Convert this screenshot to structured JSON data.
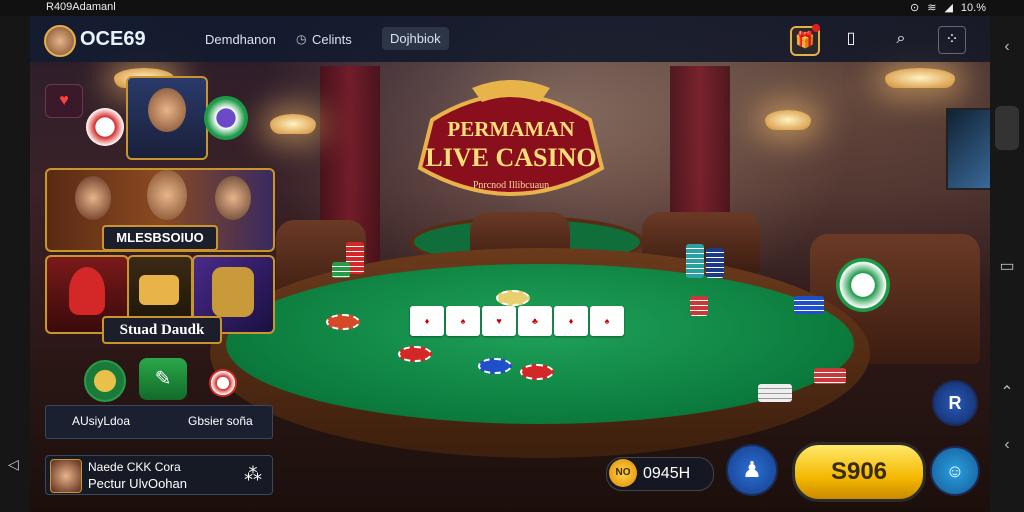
{
  "status_bar": {
    "left_text": "R409Adamanl",
    "battery": "10.%"
  },
  "header": {
    "brand": "OCE69",
    "nav": [
      "Demdhanon",
      "Celints",
      "Dojhbiok"
    ]
  },
  "left_panel": {
    "tile_caption_1": "MLESBSOIUO",
    "tile_caption_2": "Stuad Daudk",
    "tabs": [
      "AUsiyLdoa",
      "Gbsier soña"
    ]
  },
  "user": {
    "line1": "Naede CKK Cora",
    "line2": "Pectur UlvOohan"
  },
  "sign": {
    "line1": "PERMAMAN",
    "line2": "LIVE CASINO",
    "line3": "Pnrcnod Illibcuaun"
  },
  "balance": {
    "coin": "NO",
    "value": "0945H"
  },
  "action_button": "S906",
  "colors": {
    "accent_gold": "#f4b800",
    "felt_green": "#0b7a3c",
    "header_bg": "#141c30"
  },
  "icons": [
    "gift-icon",
    "tablet-icon",
    "search-icon",
    "grid-icon",
    "home-icon",
    "back-icon",
    "recent-icon",
    "person-icon",
    "chat-icon",
    "r-icon"
  ]
}
